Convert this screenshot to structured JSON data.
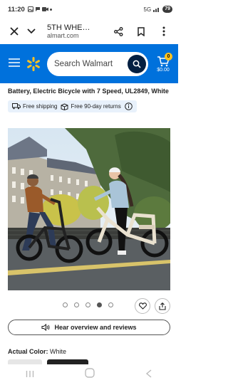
{
  "status": {
    "time": "11:20",
    "network": "5G",
    "signal_suffix": "ull",
    "battery": "79"
  },
  "browser": {
    "title": "5TH WHE…",
    "url": "almart.com"
  },
  "header": {
    "search_placeholder": "Search Walmart",
    "cart_count": "0",
    "cart_total": "$0.00",
    "brand_color": "#0071dc",
    "spark_color": "#ffc220"
  },
  "product": {
    "title": "Battery, Electric Bicycle with 7 Speed, UL2849, White",
    "free_shipping": "Free shipping",
    "free_returns": "Free 90-day returns",
    "overview_label": "Hear overview and reviews",
    "actual_color_label": "Actual Color:",
    "actual_color_value": "White"
  },
  "carousel": {
    "total": 5,
    "active_index": 3
  }
}
